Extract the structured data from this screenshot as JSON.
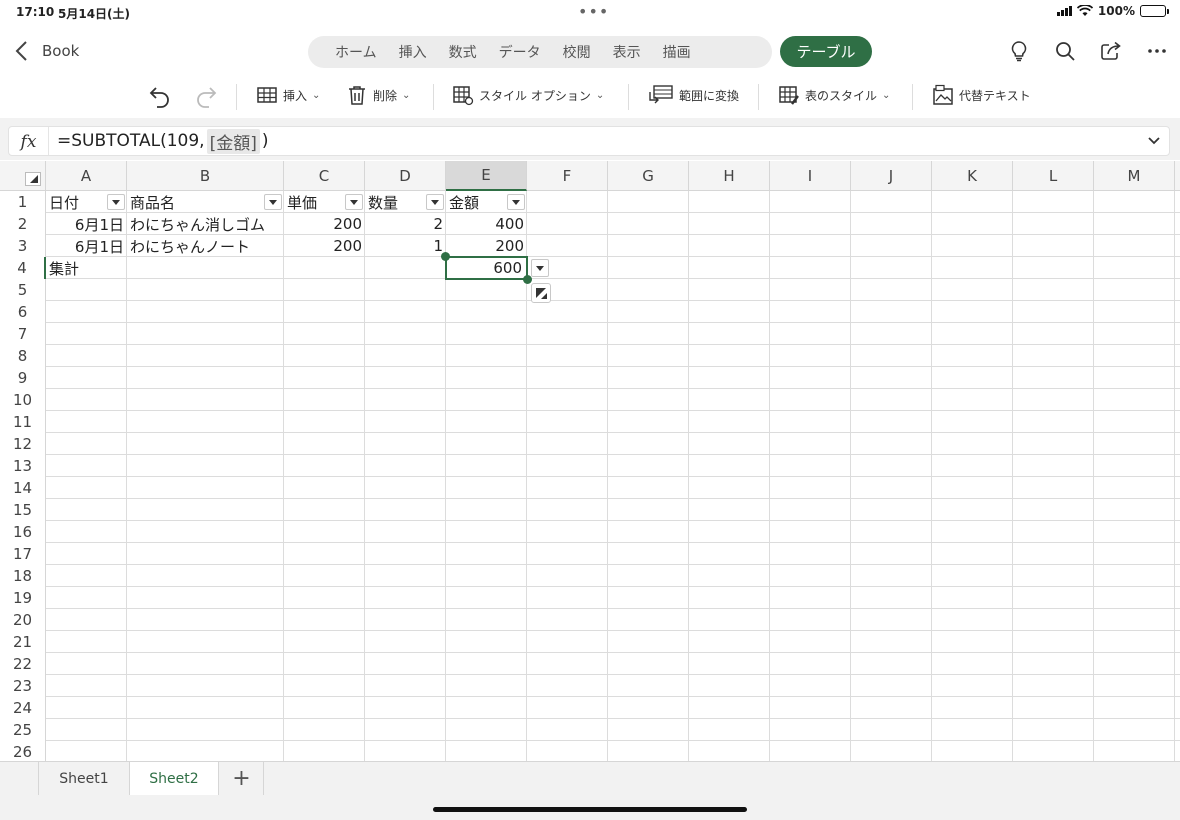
{
  "status": {
    "time": "17:10",
    "date": "5月14日(土)",
    "battery": "100%"
  },
  "nav": {
    "back_label": "Book",
    "tabs": [
      "ホーム",
      "挿入",
      "数式",
      "データ",
      "校閲",
      "表示",
      "描画"
    ],
    "active_tab": "テーブル"
  },
  "toolbar": {
    "insert": "挿入",
    "delete": "削除",
    "style_options": "スタイル オプション",
    "convert_range": "範囲に変換",
    "table_style": "表のスタイル",
    "alt_text": "代替テキスト"
  },
  "formula": {
    "prefix": "=SUBTOTAL(109,",
    "ref": "[金額]",
    "suffix": ")",
    "fx": "fx"
  },
  "columns": [
    "A",
    "B",
    "C",
    "D",
    "E",
    "F",
    "G",
    "H",
    "I",
    "J",
    "K",
    "L",
    "M"
  ],
  "rows": [
    "1",
    "2",
    "3",
    "4",
    "5",
    "6",
    "7",
    "8",
    "9",
    "10",
    "11",
    "12",
    "13",
    "14",
    "15",
    "16",
    "17",
    "18",
    "19",
    "20",
    "21",
    "22",
    "23",
    "24",
    "25",
    "26"
  ],
  "table": {
    "headers": [
      "日付",
      "商品名",
      "単価",
      "数量",
      "金額"
    ],
    "data": [
      [
        "6月1日",
        "わにちゃん消しゴム",
        "200",
        "2",
        "400"
      ],
      [
        "6月1日",
        "わにちゃんノート",
        "200",
        "1",
        "200"
      ]
    ],
    "total_label": "集計",
    "total_value": "600"
  },
  "sheets": [
    "Sheet1",
    "Sheet2"
  ],
  "active_sheet": "Sheet2",
  "colors": {
    "accent": "#2f6f45"
  }
}
